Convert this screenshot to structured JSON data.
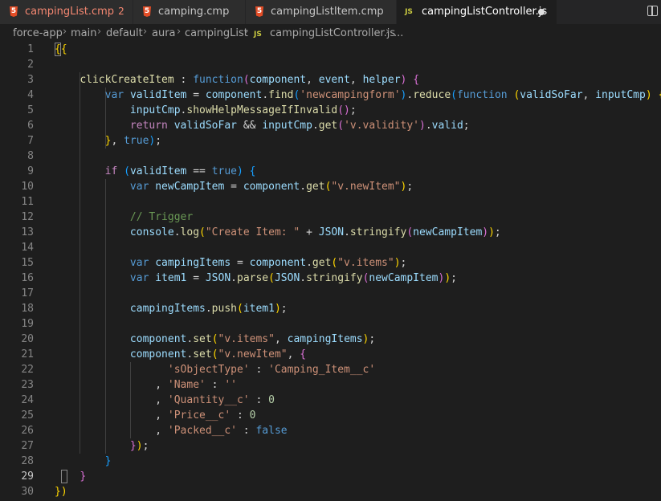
{
  "tabs": [
    {
      "label": "campingList.cmp",
      "badge": "2",
      "icon": "html5-icon",
      "error": true,
      "active": false
    },
    {
      "label": "camping.cmp",
      "badge": "",
      "icon": "html5-icon",
      "error": false,
      "active": false
    },
    {
      "label": "campingListItem.cmp",
      "badge": "",
      "icon": "html5-icon",
      "error": false,
      "active": false
    },
    {
      "label": "campingListController.js",
      "badge": "",
      "icon": "js-icon",
      "error": false,
      "active": true
    }
  ],
  "js_icon_text": "JS",
  "html_icon_text": "5",
  "breadcrumb": [
    "force-app",
    "main",
    "default",
    "aura",
    "campingList",
    "campingListController.js",
    "..."
  ],
  "current_line": 29,
  "line_numbers": [
    1,
    2,
    3,
    4,
    5,
    6,
    7,
    8,
    9,
    10,
    11,
    12,
    13,
    14,
    15,
    16,
    17,
    18,
    19,
    20,
    21,
    22,
    23,
    24,
    25,
    26,
    27,
    28,
    29,
    30
  ],
  "colors": {
    "keyword": "#569cd6",
    "control": "#c586c0",
    "function": "#dcdcaa",
    "variable": "#9cdcfe",
    "string": "#ce9178",
    "comment": "#6a9955",
    "number": "#b5cea8",
    "class": "#4ec9b0",
    "bracket1": "#ffd700",
    "bracket2": "#da70d6",
    "bracket3": "#179fff",
    "text": "#d4d4d4"
  },
  "code_lines": [
    [
      [
        "{",
        "bracket1"
      ],
      [
        "{",
        "bracket1"
      ]
    ],
    [],
    [
      [
        "    ",
        ""
      ],
      [
        "clickCreateItem",
        "function"
      ],
      [
        " : ",
        ""
      ],
      [
        "function",
        "keyword"
      ],
      [
        "(",
        "bracket2"
      ],
      [
        "component",
        "variable"
      ],
      [
        ", ",
        ""
      ],
      [
        "event",
        "variable"
      ],
      [
        ", ",
        ""
      ],
      [
        "helper",
        "variable"
      ],
      [
        ")",
        "bracket2"
      ],
      [
        " ",
        ""
      ],
      [
        "{",
        "bracket2"
      ]
    ],
    [
      [
        "        ",
        ""
      ],
      [
        "var",
        "keyword"
      ],
      [
        " ",
        ""
      ],
      [
        "validItem",
        "variable"
      ],
      [
        " = ",
        ""
      ],
      [
        "component",
        "variable"
      ],
      [
        ".",
        ""
      ],
      [
        "find",
        "function"
      ],
      [
        "(",
        "bracket3"
      ],
      [
        "'newcampingform'",
        "string"
      ],
      [
        ")",
        "bracket3"
      ],
      [
        ".",
        ""
      ],
      [
        "reduce",
        "function"
      ],
      [
        "(",
        "bracket3"
      ],
      [
        "function",
        "keyword"
      ],
      [
        " ",
        ""
      ],
      [
        "(",
        "bracket1"
      ],
      [
        "validSoFar",
        "variable"
      ],
      [
        ", ",
        ""
      ],
      [
        "inputCmp",
        "variable"
      ],
      [
        ")",
        "bracket1"
      ],
      [
        " ",
        ""
      ],
      [
        "{",
        "bracket1"
      ]
    ],
    [
      [
        "            ",
        ""
      ],
      [
        "inputCmp",
        "variable"
      ],
      [
        ".",
        ""
      ],
      [
        "showHelpMessageIfInvalid",
        "function"
      ],
      [
        "()",
        "bracket2"
      ],
      [
        ";",
        ""
      ]
    ],
    [
      [
        "            ",
        ""
      ],
      [
        "return",
        "control"
      ],
      [
        " ",
        ""
      ],
      [
        "validSoFar",
        "variable"
      ],
      [
        " && ",
        ""
      ],
      [
        "inputCmp",
        "variable"
      ],
      [
        ".",
        ""
      ],
      [
        "get",
        "function"
      ],
      [
        "(",
        "bracket2"
      ],
      [
        "'v.validity'",
        "string"
      ],
      [
        ")",
        "bracket2"
      ],
      [
        ".",
        ""
      ],
      [
        "valid",
        "variable"
      ],
      [
        ";",
        ""
      ]
    ],
    [
      [
        "        ",
        ""
      ],
      [
        "}",
        "bracket1"
      ],
      [
        ", ",
        ""
      ],
      [
        "true",
        "keyword"
      ],
      [
        ")",
        "bracket3"
      ],
      [
        ";",
        ""
      ]
    ],
    [],
    [
      [
        "        ",
        ""
      ],
      [
        "if",
        "control"
      ],
      [
        " ",
        ""
      ],
      [
        "(",
        "bracket3"
      ],
      [
        "validItem",
        "variable"
      ],
      [
        " == ",
        ""
      ],
      [
        "true",
        "keyword"
      ],
      [
        ")",
        "bracket3"
      ],
      [
        " ",
        ""
      ],
      [
        "{",
        "bracket3"
      ]
    ],
    [
      [
        "            ",
        ""
      ],
      [
        "var",
        "keyword"
      ],
      [
        " ",
        ""
      ],
      [
        "newCampItem",
        "variable"
      ],
      [
        " = ",
        ""
      ],
      [
        "component",
        "variable"
      ],
      [
        ".",
        ""
      ],
      [
        "get",
        "function"
      ],
      [
        "(",
        "bracket1"
      ],
      [
        "\"v.newItem\"",
        "string"
      ],
      [
        ")",
        "bracket1"
      ],
      [
        ";",
        ""
      ]
    ],
    [],
    [
      [
        "            ",
        ""
      ],
      [
        "// Trigger",
        "comment"
      ]
    ],
    [
      [
        "            ",
        ""
      ],
      [
        "console",
        "variable"
      ],
      [
        ".",
        ""
      ],
      [
        "log",
        "function"
      ],
      [
        "(",
        "bracket1"
      ],
      [
        "\"Create Item: \"",
        "string"
      ],
      [
        " + ",
        ""
      ],
      [
        "JSON",
        "variable"
      ],
      [
        ".",
        ""
      ],
      [
        "stringify",
        "function"
      ],
      [
        "(",
        "bracket2"
      ],
      [
        "newCampItem",
        "variable"
      ],
      [
        ")",
        "bracket2"
      ],
      [
        ")",
        "bracket1"
      ],
      [
        ";",
        ""
      ]
    ],
    [],
    [
      [
        "            ",
        ""
      ],
      [
        "var",
        "keyword"
      ],
      [
        " ",
        ""
      ],
      [
        "campingItems",
        "variable"
      ],
      [
        " = ",
        ""
      ],
      [
        "component",
        "variable"
      ],
      [
        ".",
        ""
      ],
      [
        "get",
        "function"
      ],
      [
        "(",
        "bracket1"
      ],
      [
        "\"v.items\"",
        "string"
      ],
      [
        ")",
        "bracket1"
      ],
      [
        ";",
        ""
      ]
    ],
    [
      [
        "            ",
        ""
      ],
      [
        "var",
        "keyword"
      ],
      [
        " ",
        ""
      ],
      [
        "item1",
        "variable"
      ],
      [
        " = ",
        ""
      ],
      [
        "JSON",
        "variable"
      ],
      [
        ".",
        ""
      ],
      [
        "parse",
        "function"
      ],
      [
        "(",
        "bracket1"
      ],
      [
        "JSON",
        "variable"
      ],
      [
        ".",
        ""
      ],
      [
        "stringify",
        "function"
      ],
      [
        "(",
        "bracket2"
      ],
      [
        "newCampItem",
        "variable"
      ],
      [
        ")",
        "bracket2"
      ],
      [
        ")",
        "bracket1"
      ],
      [
        ";",
        ""
      ]
    ],
    [],
    [
      [
        "            ",
        ""
      ],
      [
        "campingItems",
        "variable"
      ],
      [
        ".",
        ""
      ],
      [
        "push",
        "function"
      ],
      [
        "(",
        "bracket1"
      ],
      [
        "item1",
        "variable"
      ],
      [
        ")",
        "bracket1"
      ],
      [
        ";",
        ""
      ]
    ],
    [],
    [
      [
        "            ",
        ""
      ],
      [
        "component",
        "variable"
      ],
      [
        ".",
        ""
      ],
      [
        "set",
        "function"
      ],
      [
        "(",
        "bracket1"
      ],
      [
        "\"v.items\"",
        "string"
      ],
      [
        ", ",
        ""
      ],
      [
        "campingItems",
        "variable"
      ],
      [
        ")",
        "bracket1"
      ],
      [
        ";",
        ""
      ]
    ],
    [
      [
        "            ",
        ""
      ],
      [
        "component",
        "variable"
      ],
      [
        ".",
        ""
      ],
      [
        "set",
        "function"
      ],
      [
        "(",
        "bracket1"
      ],
      [
        "\"v.newItem\"",
        "string"
      ],
      [
        ", ",
        ""
      ],
      [
        "{",
        "bracket2"
      ]
    ],
    [
      [
        "                  ",
        ""
      ],
      [
        "'sObjectType'",
        "string"
      ],
      [
        " : ",
        ""
      ],
      [
        "'Camping_Item__c'",
        "string"
      ]
    ],
    [
      [
        "                ",
        ""
      ],
      [
        ", ",
        ""
      ],
      [
        "'Name'",
        "string"
      ],
      [
        " : ",
        ""
      ],
      [
        "''",
        "string"
      ]
    ],
    [
      [
        "                ",
        ""
      ],
      [
        ", ",
        ""
      ],
      [
        "'Quantity__c'",
        "string"
      ],
      [
        " : ",
        ""
      ],
      [
        "0",
        "number"
      ]
    ],
    [
      [
        "                ",
        ""
      ],
      [
        ", ",
        ""
      ],
      [
        "'Price__c'",
        "string"
      ],
      [
        " : ",
        ""
      ],
      [
        "0",
        "number"
      ]
    ],
    [
      [
        "                ",
        ""
      ],
      [
        ", ",
        ""
      ],
      [
        "'Packed__c'",
        "string"
      ],
      [
        " : ",
        ""
      ],
      [
        "false",
        "keyword"
      ]
    ],
    [
      [
        "            ",
        ""
      ],
      [
        "}",
        "bracket2"
      ],
      [
        ")",
        "bracket1"
      ],
      [
        ";",
        ""
      ]
    ],
    [
      [
        "        ",
        ""
      ],
      [
        "}",
        "bracket3"
      ]
    ],
    [
      [
        "    ",
        ""
      ],
      [
        "}",
        "bracket2"
      ]
    ],
    [
      [
        "}",
        "bracket1"
      ],
      [
        ")",
        "bracket1"
      ]
    ],
    []
  ]
}
